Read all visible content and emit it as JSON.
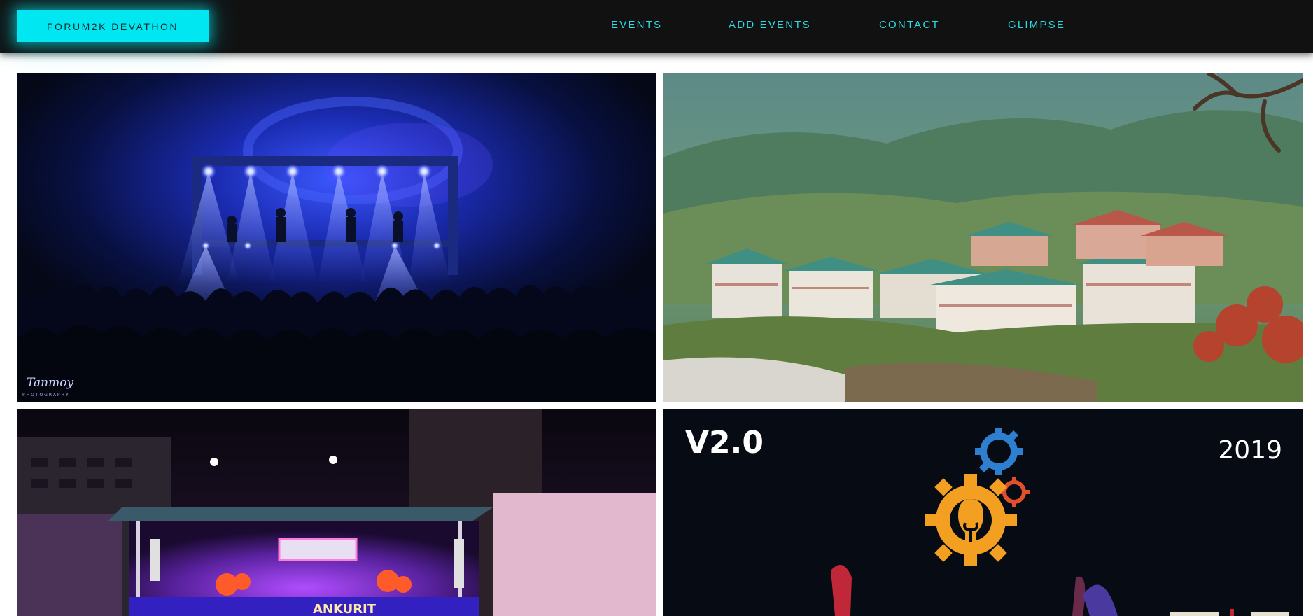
{
  "brand": {
    "label": "FORUM2K DEVATHON"
  },
  "nav": {
    "links": [
      {
        "label": "EVENTS"
      },
      {
        "label": "ADD EVENTS"
      },
      {
        "label": "CONTACT"
      },
      {
        "label": "GLIMPSE"
      }
    ]
  },
  "colors": {
    "navbar_bg": "#111111",
    "accent": "#00e7f2",
    "nav_text": "#27dde8"
  },
  "gallery": {
    "tiles": [
      {
        "scene": "concert-stage-blue-lights",
        "watermark": "Tanmoy",
        "watermark_sub": "PHOTOGRAPHY"
      },
      {
        "scene": "campus-buildings-in-valley"
      },
      {
        "scene": "night-stage-purple-lights",
        "stage_text": "ANKURIT"
      },
      {
        "scene": "event-poster",
        "version": "V2.0",
        "year": "2019",
        "icon": "lightbulb-gear-icon"
      }
    ]
  }
}
